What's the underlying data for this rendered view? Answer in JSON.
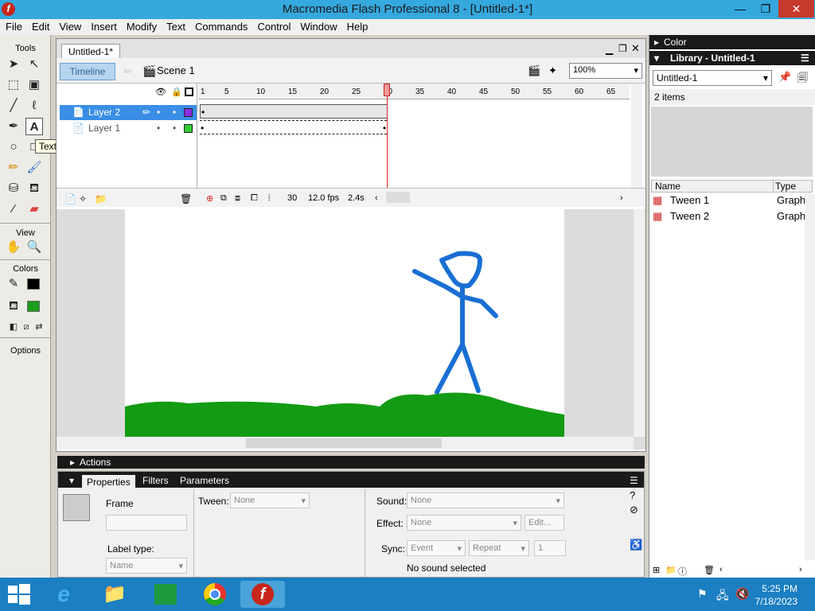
{
  "title": "Macromedia Flash Professional 8 - [Untitled-1*]",
  "menu": [
    "File",
    "Edit",
    "View",
    "Insert",
    "Modify",
    "Text",
    "Commands",
    "Control",
    "Window",
    "Help"
  ],
  "tools": {
    "header": "Tools",
    "view_label": "View",
    "colors_label": "Colors",
    "options_label": "Options",
    "tooltip": "Text Tool (T)",
    "stroke_color": "#000000",
    "fill_color": "#1a9e1a"
  },
  "document": {
    "tab": "Untitled-1*",
    "timeline_button": "Timeline",
    "scene": "Scene 1",
    "zoom": "100%",
    "layers": [
      "Layer 2",
      "Layer 1"
    ],
    "layer_colors": [
      "#8a2be2",
      "#33cc33"
    ],
    "ruler": [
      "1",
      "5",
      "10",
      "15",
      "20",
      "25",
      "30",
      "35",
      "40",
      "45",
      "50",
      "55",
      "60",
      "65"
    ],
    "current_frame": "30",
    "fps": "12.0 fps",
    "time": "2.4s"
  },
  "actions_label": "Actions",
  "properties": {
    "tabs": [
      "Properties",
      "Filters",
      "Parameters"
    ],
    "frame_label": "Frame",
    "tween_label": "Tween:",
    "tween_value": "None",
    "sound_label": "Sound:",
    "sound_value": "None",
    "effect_label": "Effect:",
    "effect_value": "None",
    "edit_button": "Edit...",
    "label_type_label": "Label type:",
    "label_type_value": "Name",
    "sync_label": "Sync:",
    "sync_value": "Event",
    "repeat_value": "Repeat",
    "repeat_count": "1",
    "no_sound": "No sound selected"
  },
  "right_panel": {
    "color_header": "Color",
    "library_header": "Library - Untitled-1",
    "library_select": "Untitled-1",
    "item_count": "2 items",
    "col_name": "Name",
    "col_type": "Type",
    "items": [
      {
        "name": "Tween 1",
        "type": "Graph"
      },
      {
        "name": "Tween 2",
        "type": "Graph"
      }
    ]
  },
  "taskbar": {
    "time": "5:25 PM",
    "date": "7/18/2023"
  }
}
